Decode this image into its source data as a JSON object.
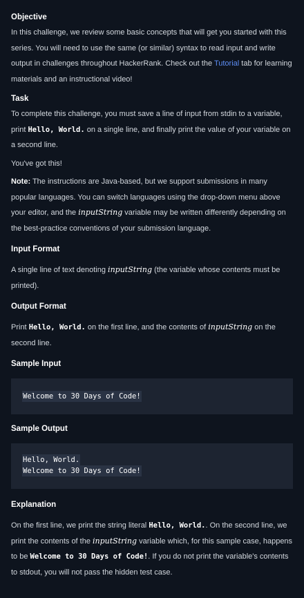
{
  "objective": {
    "heading": "Objective",
    "p1": "In this challenge, we review some basic concepts that will get you started with this series. You will need to use the same (or similar) syntax to read input and write output in challenges throughout HackerRank. Check out the ",
    "link": "Tutorial",
    "p1_end": " tab for learning materials and an instructional video!"
  },
  "task": {
    "heading": "Task",
    "p1_a": "To complete this challenge, you must save a line of input from stdin to a variable, print ",
    "p1_code": "Hello, World.",
    "p1_b": " on a single line, and finally print the value of your variable on a second line.",
    "p2": "You've got this!",
    "note_label": "Note:",
    "note_a": " The instructions are Java-based, but we support submissions in many popular languages. You can switch languages using the drop-down menu above your editor, and the ",
    "note_var": "inputString",
    "note_b": " variable may be written differently depending on the best-practice conventions of your submission language."
  },
  "input_format": {
    "heading": "Input Format",
    "text_a": "A single line of text denoting ",
    "text_var": "inputString",
    "text_b": " (the variable whose contents must be printed)."
  },
  "output_format": {
    "heading": "Output Format",
    "text_a": "Print ",
    "text_code": "Hello, World.",
    "text_b": " on the first line, and the contents of ",
    "text_var": "inputString",
    "text_c": " on the second line."
  },
  "sample_input": {
    "heading": "Sample Input",
    "lines": [
      "Welcome to 30 Days of Code!"
    ]
  },
  "sample_output": {
    "heading": "Sample Output",
    "lines": [
      "Hello, World.",
      "Welcome to 30 Days of Code!"
    ]
  },
  "explanation": {
    "heading": "Explanation",
    "text_a": "On the first line, we print the string literal ",
    "code1": "Hello, World.",
    "text_b": ". On the second line, we print the contents of the ",
    "var": "inputString",
    "text_c": " variable which, for this sample case, happens to be ",
    "code2": "Welcome to 30 Days of Code!",
    "text_d": ". If you do not print the variable's contents to stdout, you will not pass the hidden test case."
  },
  "colors": {
    "background": "#0e141e",
    "code_block": "#1d2431",
    "link": "#5d8ef5"
  }
}
